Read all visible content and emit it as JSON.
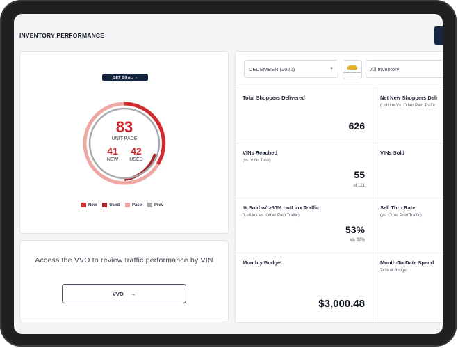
{
  "header": {
    "title": "INVENTORY PERFORMANCE"
  },
  "gauge": {
    "set_goal_label": "SET GOAL",
    "set_goal_arrow": "›",
    "unit_pace_value": "83",
    "unit_pace_label": "UNIT PACE",
    "new_value": "41",
    "new_label": "NEW",
    "used_value": "42",
    "used_label": "USED",
    "legend": [
      {
        "label": "New",
        "color": "#d12b2f"
      },
      {
        "label": "Used",
        "color": "#a5242a"
      },
      {
        "label": "Pace",
        "color": "#eea7a3"
      },
      {
        "label": "Prev",
        "color": "#a8a9ad"
      }
    ]
  },
  "vvo": {
    "text": "Access the VVO to review traffic performance by VIN",
    "button_label": "VVO",
    "button_arrow": "→"
  },
  "filters": {
    "month": "DECEMBER (2022)",
    "logo_text": "CARFAX REPORT",
    "inventory": "All Inventory"
  },
  "metrics": [
    {
      "title": "Total Shoppers Delivered",
      "sub": "",
      "value": "626",
      "foot": ""
    },
    {
      "title": "Net New Shoppers Deli",
      "sub": "(LotLinx Vs. Other Paid Traffic",
      "value": "",
      "foot": ""
    },
    {
      "title": "VINs Reached",
      "sub": "(vs. VINs Total)",
      "value": "55",
      "foot": "of 121"
    },
    {
      "title": "VINs Sold",
      "sub": "",
      "value": "",
      "foot": ""
    },
    {
      "title": "% Sold w/ >50% LotLinx Traffic",
      "sub": "(LotLinx Vs. Other Paid Traffic)",
      "value": "53%",
      "foot": "vs. 33%"
    },
    {
      "title": "Sell Thru Rate",
      "sub": "(vs. Other Paid Traffic)",
      "value": "",
      "foot": ""
    },
    {
      "title": "Monthly Budget",
      "sub": "",
      "value": "$3,000.48",
      "foot": ""
    },
    {
      "title": "Month-To-Date Spend",
      "sub": "74% of Budget",
      "value": "",
      "foot": ""
    }
  ]
}
